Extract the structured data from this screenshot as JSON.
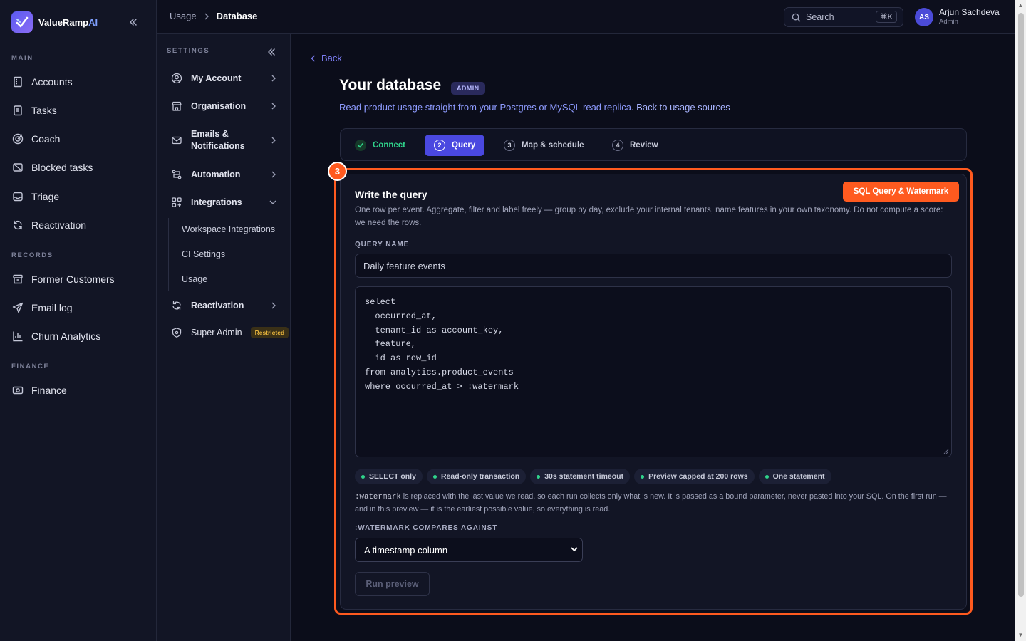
{
  "app": {
    "name_main": "ValueRamp",
    "name_accent": "AI"
  },
  "sidebar": {
    "sections": {
      "main": "MAIN",
      "records": "RECORDS",
      "finance": "FINANCE"
    },
    "main_items": [
      {
        "label": "Accounts",
        "icon": "building-icon"
      },
      {
        "label": "Tasks",
        "icon": "clipboard-icon"
      },
      {
        "label": "Coach",
        "icon": "target-icon"
      },
      {
        "label": "Blocked tasks",
        "icon": "blocked-icon"
      },
      {
        "label": "Triage",
        "icon": "inbox-icon"
      },
      {
        "label": "Reactivation",
        "icon": "refresh-icon"
      }
    ],
    "records_items": [
      {
        "label": "Former Customers",
        "icon": "archive-icon"
      },
      {
        "label": "Email log",
        "icon": "send-icon"
      },
      {
        "label": "Churn Analytics",
        "icon": "chart-icon"
      }
    ],
    "finance_items": [
      {
        "label": "Finance",
        "icon": "money-icon"
      }
    ]
  },
  "settings": {
    "label": "SETTINGS",
    "items": {
      "my_account": "My Account",
      "organisation": "Organisation",
      "emails_line1": "Emails &",
      "emails_line2": "Notifications",
      "automation": "Automation",
      "integrations": "Integrations",
      "reactivation": "Reactivation",
      "super_admin": "Super Admin",
      "restricted_badge": "Restricted"
    },
    "sub_items": [
      "Workspace Integrations",
      "CI Settings",
      "Usage"
    ]
  },
  "header": {
    "breadcrumb": [
      "Usage",
      "Database"
    ],
    "search_placeholder": "Search",
    "search_shortcut": "⌘K",
    "user": {
      "initials": "AS",
      "name": "Arjun Sachdeva",
      "role": "Admin"
    }
  },
  "page": {
    "back": "Back",
    "title": "Your database",
    "tag": "ADMIN",
    "description": "Read product usage straight from your Postgres or MySQL read replica.",
    "description_link": "Back to usage sources"
  },
  "steps": [
    {
      "num": "✓",
      "label": "Connect",
      "state": "done"
    },
    {
      "num": "2",
      "label": "Query",
      "state": "active"
    },
    {
      "num": "3",
      "label": "Map & schedule",
      "state": "todo"
    },
    {
      "num": "4",
      "label": "Review",
      "state": "todo"
    }
  ],
  "annotation": {
    "marker": "3",
    "tag": "SQL Query & Watermark"
  },
  "card": {
    "title": "Write the query",
    "description": "One row per event. Aggregate, filter and label freely — group by day, exclude your internal tenants, name features in your own taxonomy. Do not compute a score: we need the rows.",
    "query_name_label": "QUERY NAME",
    "query_name_value": "Daily feature events",
    "sql": "select\n  occurred_at,\n  tenant_id as account_key,\n  feature,\n  id as row_id\nfrom analytics.product_events\nwhere occurred_at > :watermark",
    "chips": [
      "SELECT only",
      "Read-only transaction",
      "30s statement timeout",
      "Preview capped at 200 rows",
      "One statement"
    ],
    "note_code": ":watermark",
    "note_text": " is replaced with the last value we read, so each run collects only what is new. It is passed as a bound parameter, never pasted into your SQL. On the first run — and in this preview — it is the earliest possible value, so everything is read.",
    "watermark_label": ":WATERMARK COMPARES AGAINST",
    "watermark_value": "A timestamp column",
    "run_button": "Run preview"
  },
  "colors": {
    "accent": "#4a48e0",
    "highlight": "#ff5a1f",
    "success": "#2fd38b"
  }
}
